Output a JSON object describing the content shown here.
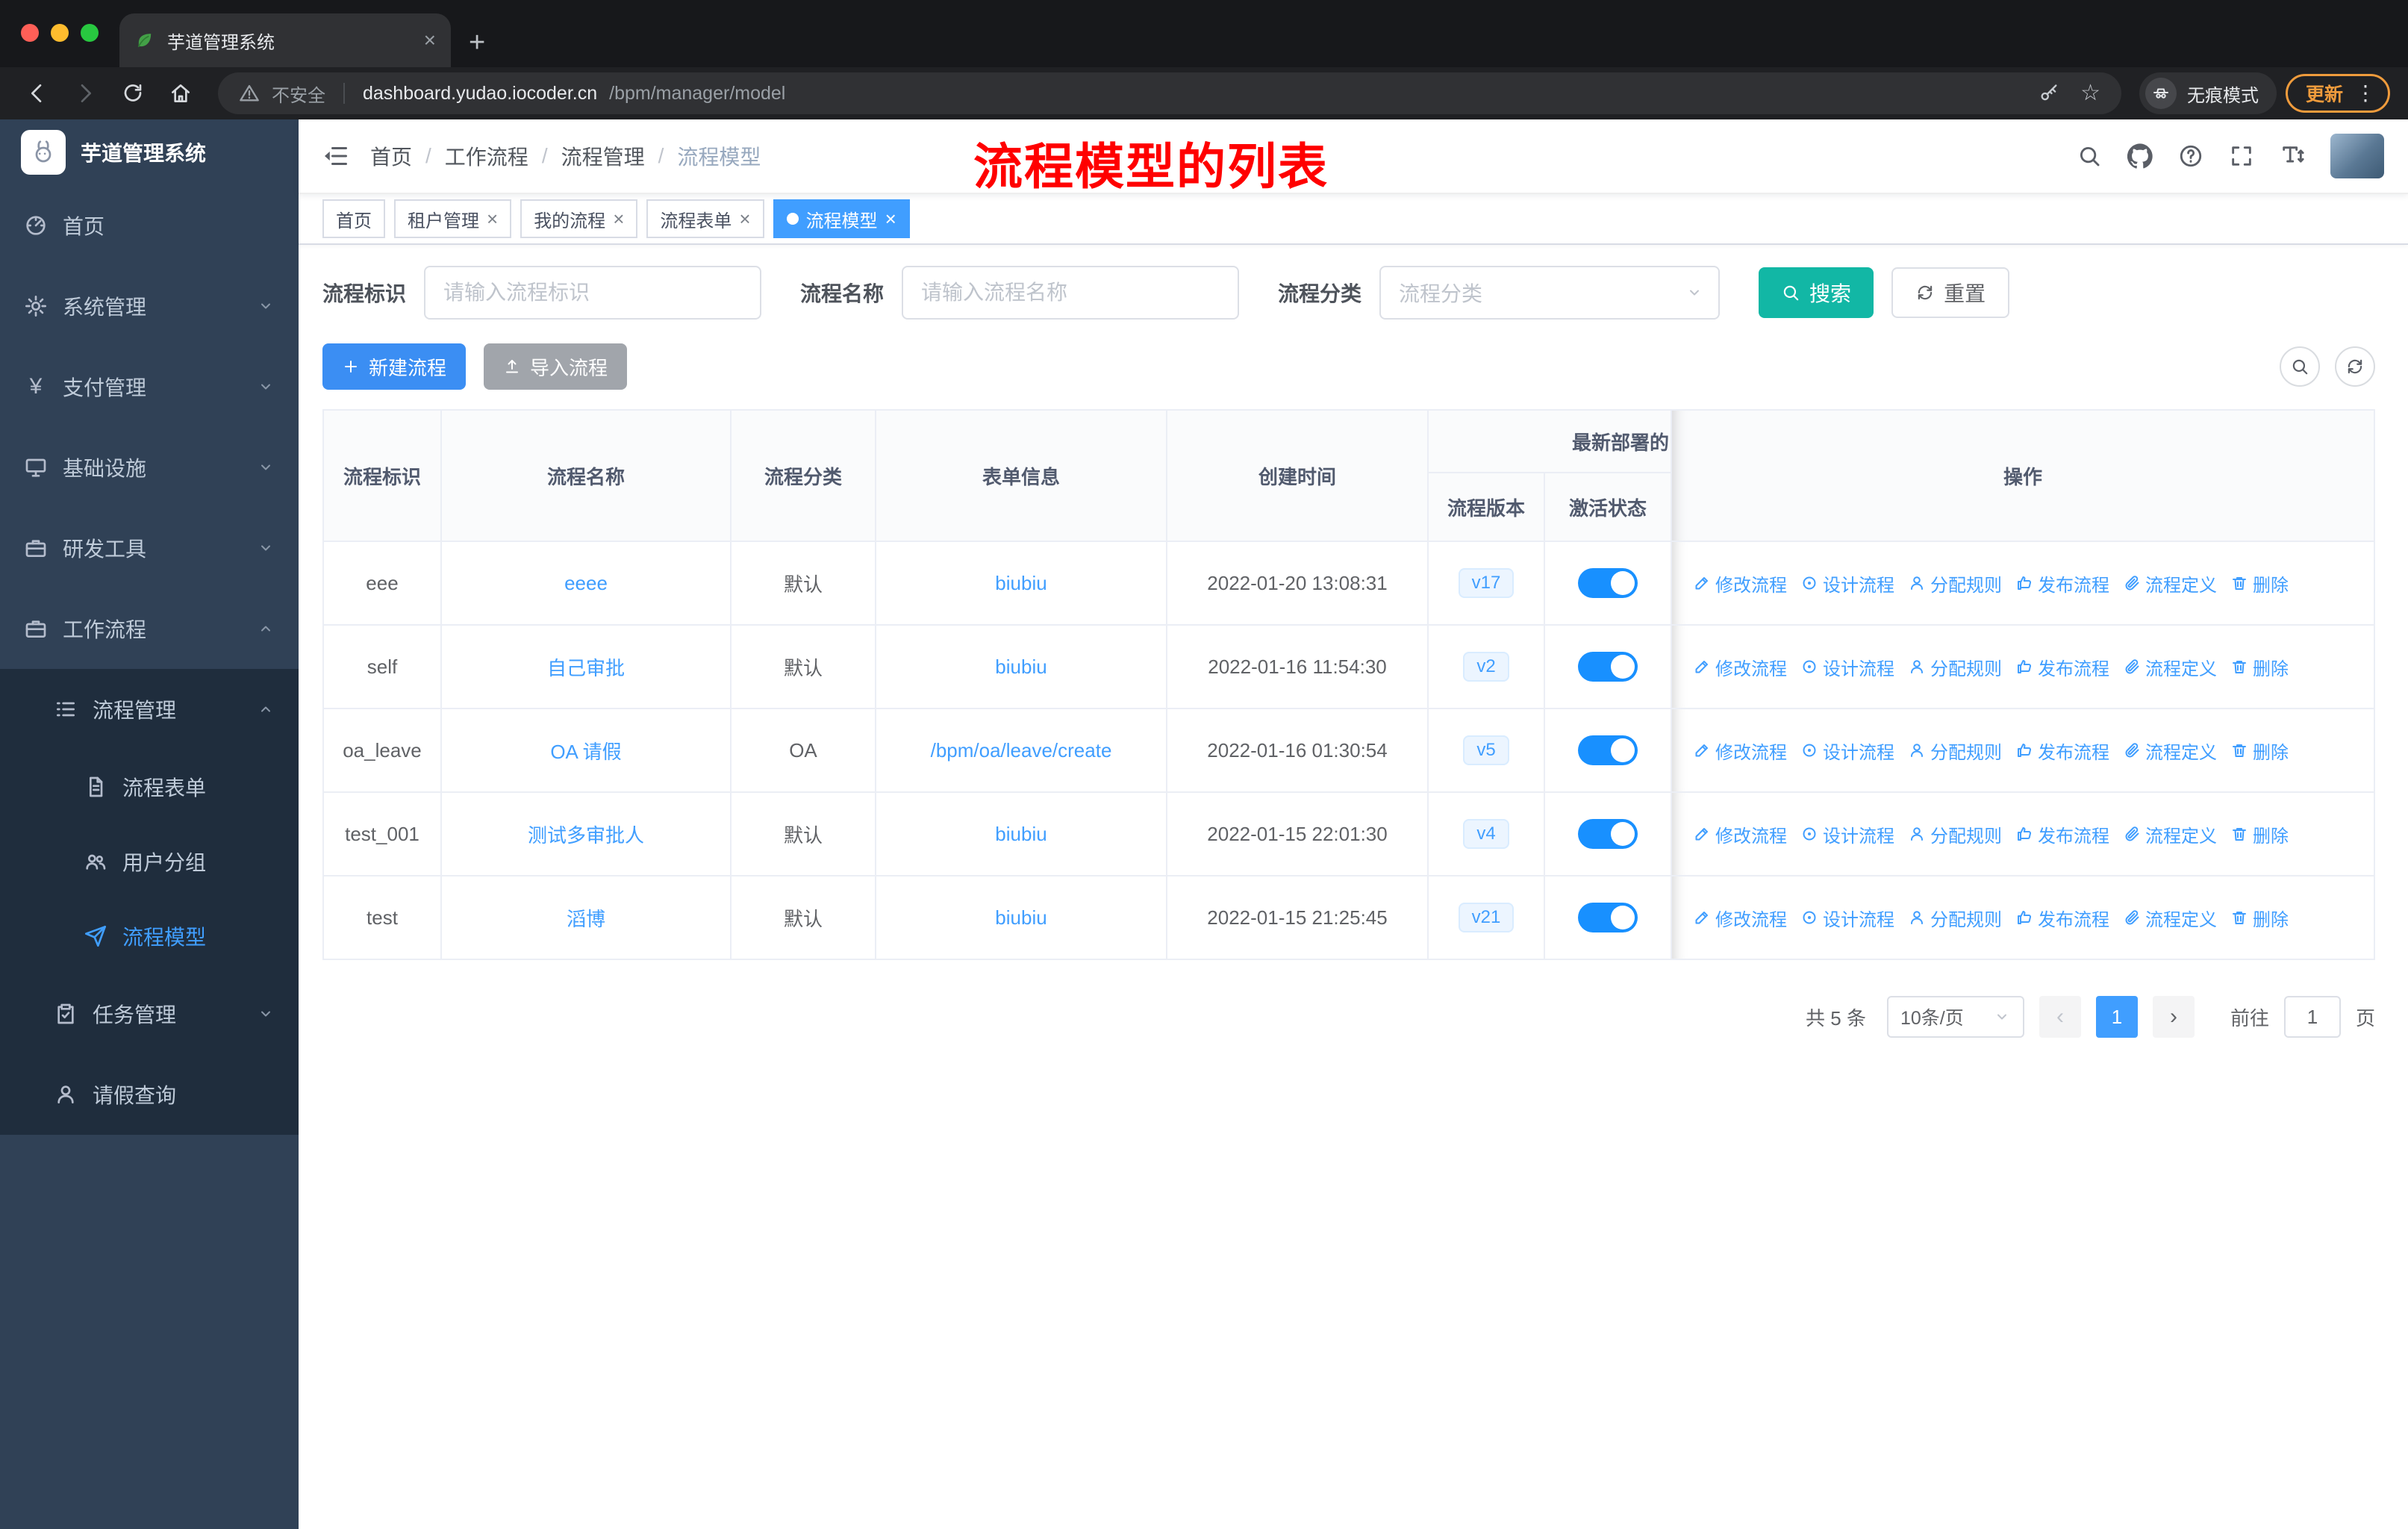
{
  "theme": {
    "accent_blue": "#409eff",
    "search_teal": "#12b7a5",
    "toggle_on_blue": "#1890ff",
    "annotation_red": "#ff0000",
    "sidebar_bg": "#304156",
    "submenu_bg": "#1f2d3d"
  },
  "browser": {
    "tab_title": "芋道管理系统",
    "security_label": "不安全",
    "url_domain": "dashboard.yudao.iocoder.cn",
    "url_path": "/bpm/manager/model",
    "incognito_label": "无痕模式",
    "update_label": "更新"
  },
  "sidebar": {
    "logo_title": "芋道管理系统",
    "menu": [
      {
        "label": "首页"
      },
      {
        "label": "系统管理"
      },
      {
        "label": "支付管理"
      },
      {
        "label": "基础设施"
      },
      {
        "label": "研发工具"
      },
      {
        "label": "工作流程"
      },
      {
        "label": "流程管理"
      },
      {
        "label": "流程表单"
      },
      {
        "label": "用户分组"
      },
      {
        "label": "流程模型"
      },
      {
        "label": "任务管理"
      },
      {
        "label": "请假查询"
      }
    ]
  },
  "header": {
    "breadcrumb": {
      "items": [
        "首页",
        "工作流程",
        "流程管理",
        "流程模型"
      ],
      "separator": "/"
    },
    "annotation": "流程模型的列表"
  },
  "tags": [
    {
      "label": "首页"
    },
    {
      "label": "租户管理"
    },
    {
      "label": "我的流程"
    },
    {
      "label": "流程表单"
    },
    {
      "label": "流程模型"
    }
  ],
  "filters": {
    "key_label": "流程标识",
    "key_placeholder": "请输入流程标识",
    "name_label": "流程名称",
    "name_placeholder": "请输入流程名称",
    "category_label": "流程分类",
    "category_placeholder": "流程分类",
    "search_button": "搜索",
    "reset_button": "重置"
  },
  "toolbar": {
    "create_button": "新建流程",
    "import_button": "导入流程"
  },
  "table": {
    "columns": {
      "key": "流程标识",
      "name": "流程名称",
      "category": "流程分类",
      "form": "表单信息",
      "created": "创建时间",
      "deploy_group": "最新部署的",
      "version": "流程版本",
      "status": "激活状态",
      "ops": "操作"
    },
    "action_labels": [
      "修改流程",
      "设计流程",
      "分配规则",
      "发布流程",
      "流程定义",
      "删除"
    ],
    "rows": [
      {
        "key": "eee",
        "name": "eeee",
        "category": "默认",
        "form": "biubiu",
        "created": "2022-01-20 13:08:31",
        "version": "v17",
        "active": true
      },
      {
        "key": "self",
        "name": "自己审批",
        "category": "默认",
        "form": "biubiu",
        "created": "2022-01-16 11:54:30",
        "version": "v2",
        "active": true
      },
      {
        "key": "oa_leave",
        "name": "OA 请假",
        "category": "OA",
        "form": "/bpm/oa/leave/create",
        "created": "2022-01-16 01:30:54",
        "version": "v5",
        "active": true
      },
      {
        "key": "test_001",
        "name": "测试多审批人",
        "category": "默认",
        "form": "biubiu",
        "created": "2022-01-15 22:01:30",
        "version": "v4",
        "active": true
      },
      {
        "key": "test",
        "name": "滔博",
        "category": "默认",
        "form": "biubiu",
        "created": "2022-01-15 21:25:45",
        "version": "v21",
        "active": true
      }
    ]
  },
  "pagination": {
    "total": "共 5 条",
    "page_size": "10条/页",
    "current": "1",
    "goto_label": "前往",
    "goto_value": "1",
    "goto_unit": "页"
  }
}
